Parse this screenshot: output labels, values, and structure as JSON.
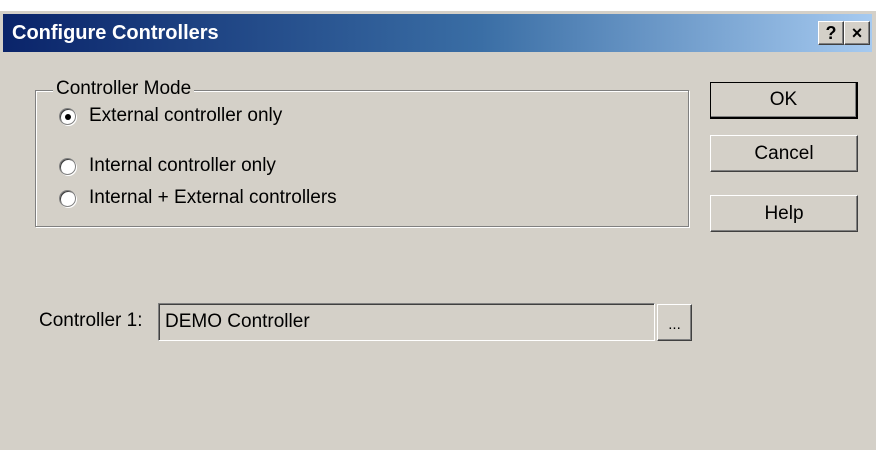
{
  "window": {
    "title": "Configure Controllers",
    "help_button": "?",
    "close_button": "×"
  },
  "controller_mode": {
    "legend": "Controller Mode",
    "options": [
      {
        "label": "External controller only",
        "selected": true
      },
      {
        "label": "Internal controller only",
        "selected": false
      },
      {
        "label": "Internal + External controllers",
        "selected": false
      }
    ]
  },
  "buttons": {
    "ok": "OK",
    "cancel": "Cancel",
    "help": "Help"
  },
  "controller1": {
    "label": "Controller 1:",
    "value": "DEMO Controller",
    "browse": "..."
  },
  "colors": {
    "face": "#d4d0c8",
    "title_start": "#0a246a",
    "title_end": "#a6caf0"
  }
}
